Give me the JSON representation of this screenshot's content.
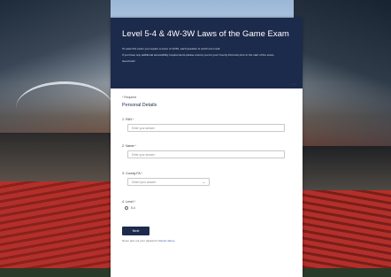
{
  "form": {
    "title": "Level 5-4 & 4W-3W Laws of the Game Exam",
    "intro_1": "To pass this exam you require a score of 12/15, each question is worth one mark.",
    "intro_2": "If you have any additional accessibility requirements please ensure you let your County FA know prior to the start of the exam.",
    "intro_3": "Good luck!",
    "header_dots": "...",
    "required_note": "Required",
    "section_title": "Personal Details",
    "questions": [
      {
        "number": "1.",
        "label": "FAN",
        "placeholder": "Enter your answer"
      },
      {
        "number": "2.",
        "label": "Name",
        "placeholder": "Enter your answer"
      },
      {
        "number": "3.",
        "label": "County FA",
        "placeholder": "Select your answer"
      },
      {
        "number": "4.",
        "label": "Level",
        "option": "5-4"
      }
    ],
    "required_star": "*",
    "submit_label": "Next",
    "footer_text": "Never give out your password.",
    "footer_link": "Report abuse"
  },
  "colors": {
    "header_bg": "#1c2a4b",
    "button_bg": "#1c2a4b",
    "required_star": "#c4314b"
  },
  "icons": {
    "select_chevron": "chevron-down-icon"
  }
}
